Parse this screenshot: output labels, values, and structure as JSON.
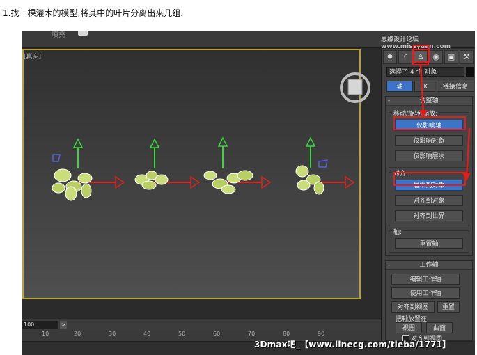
{
  "caption": "1.找一棵灌木的模型,将其中的叶片分离出来几组.",
  "watermark_top": "思缘设计论坛 www.missyuan.com",
  "watermark_bottom": "3Dmax吧_【www.linecg.com/tieba/1771】",
  "top_toolbar": {
    "fill_label": "填充"
  },
  "viewport": {
    "label": "[真实]"
  },
  "timeline": {
    "frame_value": "100",
    "next_label": ">",
    "ruler_ticks": [
      "10",
      "20",
      "30",
      "40",
      "50",
      "60",
      "70",
      "80",
      "90"
    ]
  },
  "panel": {
    "selection_text": "选择了 4 个 对象",
    "tabs": [
      "轴",
      "IK",
      "链接信息"
    ],
    "adjust_pivot": {
      "title": "调整轴",
      "move_group_label": "移动/旋转/缩放:",
      "buttons": [
        "仅影响轴",
        "仅影响对象",
        "仅影响层次"
      ],
      "align_group_label": "对齐:",
      "align_buttons": [
        "居中到对象",
        "对齐到对象",
        "对齐到世界"
      ],
      "pivot_group_label": "轴:",
      "reset_button": "重置轴"
    },
    "working_pivot": {
      "title": "工作轴",
      "buttons": [
        "编辑工作轴",
        "使用工作轴"
      ],
      "align_view_button": "对齐到视图",
      "reset_button": "重置",
      "place_label": "把轴放置在:",
      "view_button": "视图",
      "surface_button": "曲面",
      "align_checkbox_label": "对齐到视图"
    }
  },
  "icons": [
    "sun-icon",
    "arc-icon",
    "hierarchy-icon",
    "circle-icon",
    "monitor-icon",
    "hammer-icon"
  ],
  "colors": {
    "active_blue": "#3b74c8",
    "highlight_red": "#e11d1d",
    "viewport_border": "#b8a137"
  }
}
